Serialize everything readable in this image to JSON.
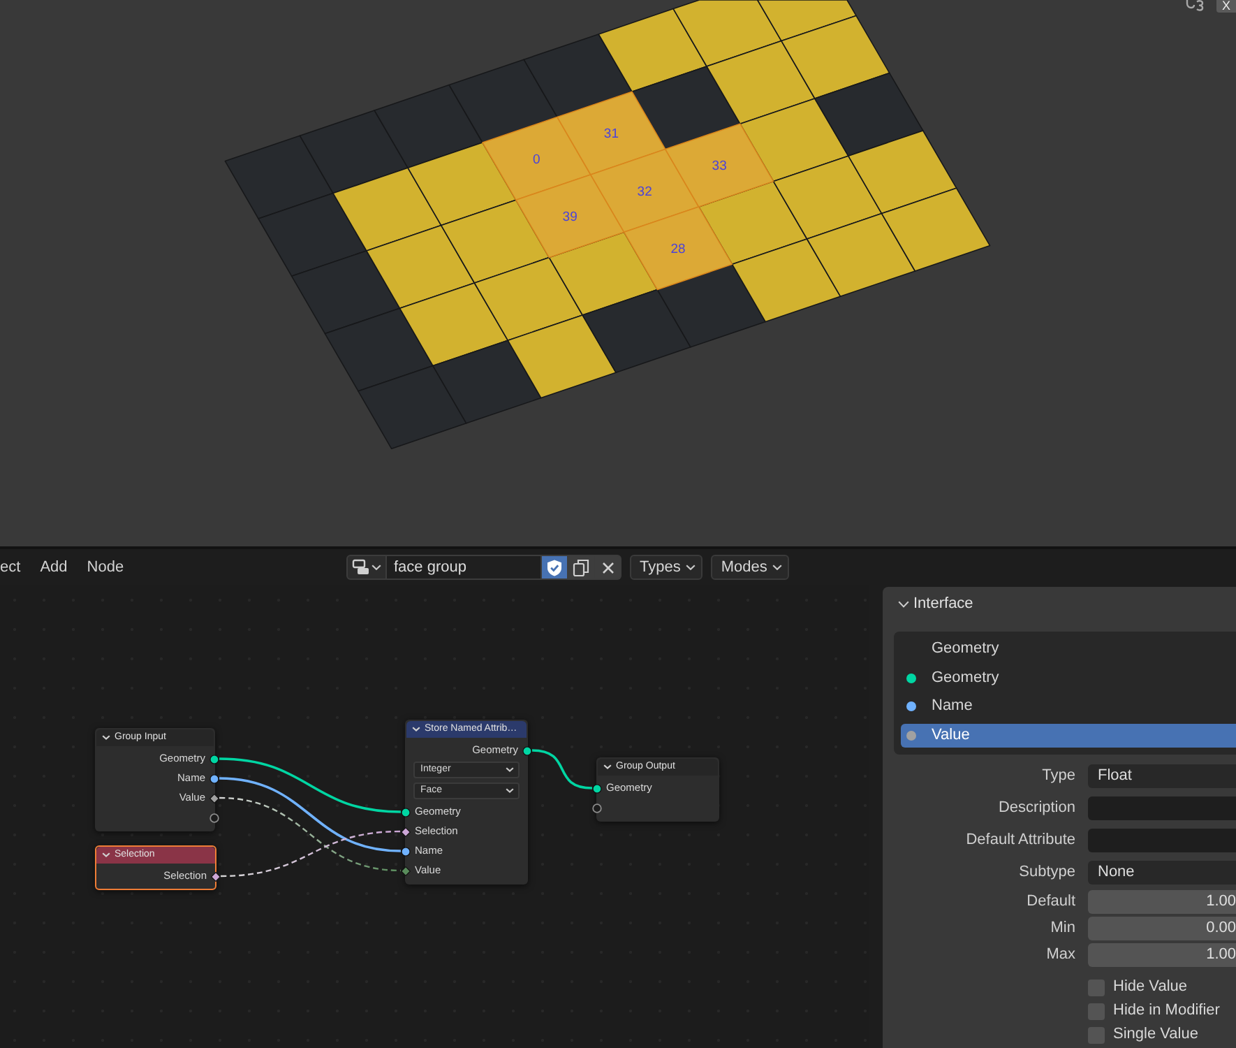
{
  "viewport": {
    "mesh": {
      "rows": [
        {
          "faces": [
            {
              "on": false,
              "selected": false
            },
            {
              "on": false,
              "selected": false
            },
            {
              "on": false,
              "selected": false
            },
            {
              "on": false,
              "selected": false
            },
            {
              "on": false,
              "selected": false
            },
            {
              "on": true,
              "selected": false
            },
            {
              "on": true,
              "selected": false
            },
            {
              "on": true,
              "selected": false
            }
          ]
        },
        {
          "faces": [
            {
              "on": false,
              "selected": false
            },
            {
              "on": true,
              "selected": false
            },
            {
              "on": true,
              "selected": false
            },
            {
              "on": true,
              "selected": true,
              "index_label": "0"
            },
            {
              "on": true,
              "selected": true,
              "index_label": "31"
            },
            {
              "on": false,
              "selected": false
            },
            {
              "on": true,
              "selected": false
            },
            {
              "on": true,
              "selected": false
            }
          ]
        },
        {
          "faces": [
            {
              "on": false,
              "selected": false
            },
            {
              "on": true,
              "selected": false
            },
            {
              "on": true,
              "selected": false
            },
            {
              "on": true,
              "selected": true,
              "index_label": "39"
            },
            {
              "on": true,
              "selected": true,
              "index_label": "32"
            },
            {
              "on": true,
              "selected": true,
              "index_label": "33"
            },
            {
              "on": true,
              "selected": false
            },
            {
              "on": false,
              "selected": false
            }
          ]
        },
        {
          "faces": [
            {
              "on": false,
              "selected": false
            },
            {
              "on": true,
              "selected": false
            },
            {
              "on": true,
              "selected": false
            },
            {
              "on": true,
              "selected": false
            },
            {
              "on": true,
              "selected": true,
              "index_label": "28"
            },
            {
              "on": true,
              "selected": false
            },
            {
              "on": true,
              "selected": false
            },
            {
              "on": true,
              "selected": false
            }
          ]
        },
        {
          "faces": [
            {
              "on": false,
              "selected": false
            },
            {
              "on": false,
              "selected": false
            },
            {
              "on": true,
              "selected": false
            },
            {
              "on": false,
              "selected": false
            },
            {
              "on": false,
              "selected": false
            },
            {
              "on": true,
              "selected": false
            },
            {
              "on": true,
              "selected": false
            },
            {
              "on": true,
              "selected": false
            }
          ]
        }
      ]
    },
    "gizmo": {
      "label": "X"
    }
  },
  "header": {
    "menus": [
      "ect",
      "Add",
      "Node"
    ],
    "tree_name": "face group",
    "fake_user": true,
    "filters": [
      "Types",
      "Modes"
    ]
  },
  "nodes": [
    {
      "title": "Group Input",
      "color": "#262626",
      "selected": false,
      "rows": [
        {
          "kind": "output",
          "label": "Geometry",
          "socket": {
            "kind": "circle",
            "color": "#00d6a3"
          }
        },
        {
          "kind": "output",
          "label": "Name",
          "socket": {
            "kind": "circle",
            "color": "#70b2ff"
          }
        },
        {
          "kind": "output",
          "label": "Value",
          "socket": {
            "kind": "diamond",
            "color": "#a1a1a1"
          }
        },
        {
          "kind": "output",
          "socket": {
            "kind": "empty"
          }
        }
      ]
    },
    {
      "title": "Selection",
      "color": "#8a3447",
      "selected": true,
      "rows": [
        {
          "kind": "output",
          "label": "Selection",
          "socket": {
            "kind": "diamond",
            "color": "#cca6d6"
          }
        }
      ]
    },
    {
      "title": "Store Named Attrib…",
      "color": "#2b3a6b",
      "selected": false,
      "rows": [
        {
          "kind": "output",
          "label": "Geometry",
          "socket": {
            "kind": "circle",
            "color": "#00d6a3"
          }
        },
        {
          "kind": "dropdown",
          "label": "Integer"
        },
        {
          "kind": "dropdown",
          "label": "Face"
        },
        {
          "kind": "input",
          "label": "Geometry",
          "socket": {
            "kind": "circle",
            "color": "#00d6a3"
          }
        },
        {
          "kind": "input",
          "label": "Selection",
          "socket": {
            "kind": "diamond",
            "color": "#cca6d6"
          }
        },
        {
          "kind": "input",
          "label": "Name",
          "socket": {
            "kind": "circle",
            "color": "#70b2ff"
          }
        },
        {
          "kind": "input",
          "label": "Value",
          "socket": {
            "kind": "diamond",
            "color": "#598c5c"
          }
        }
      ]
    },
    {
      "title": "Group Output",
      "color": "#262626",
      "selected": false,
      "rows": [
        {
          "kind": "input",
          "label": "Geometry",
          "socket": {
            "kind": "circle",
            "color": "#00d6a3"
          }
        },
        {
          "kind": "input",
          "socket": {
            "kind": "empty"
          }
        }
      ]
    }
  ],
  "links": [
    {
      "kind": "solid"
    },
    {
      "kind": "solid"
    },
    {
      "kind": "dashed"
    },
    {
      "kind": "dashed"
    },
    {
      "kind": "solid"
    }
  ],
  "sidebar": {
    "panel": {
      "title": "Interface",
      "expanded": true
    },
    "items": [
      {
        "label": "Geometry",
        "selected": false
      },
      {
        "label": "Geometry",
        "color": "#00d6a3",
        "selected": false
      },
      {
        "label": "Name",
        "color": "#70b2ff",
        "selected": false
      },
      {
        "label": "Value",
        "color": "#a1a1a1",
        "selected": true
      }
    ],
    "properties": [
      {
        "label": "Type",
        "kind": "dropdown",
        "value": "Float"
      },
      {
        "label": "Description",
        "kind": "text"
      },
      {
        "label": "Default Attribute",
        "kind": "text"
      },
      {
        "label": "Subtype",
        "kind": "dropdown",
        "value": "None"
      },
      {
        "label": "Default",
        "kind": "number",
        "value": "1.00"
      },
      {
        "label": "Min",
        "kind": "number",
        "value": "0.00"
      },
      {
        "label": "Max",
        "kind": "number",
        "value": "1.00"
      }
    ],
    "options": [
      {
        "label": "Hide Value",
        "checked": false
      },
      {
        "label": "Hide in Modifier",
        "checked": false
      },
      {
        "label": "Single Value",
        "checked": false
      }
    ]
  }
}
